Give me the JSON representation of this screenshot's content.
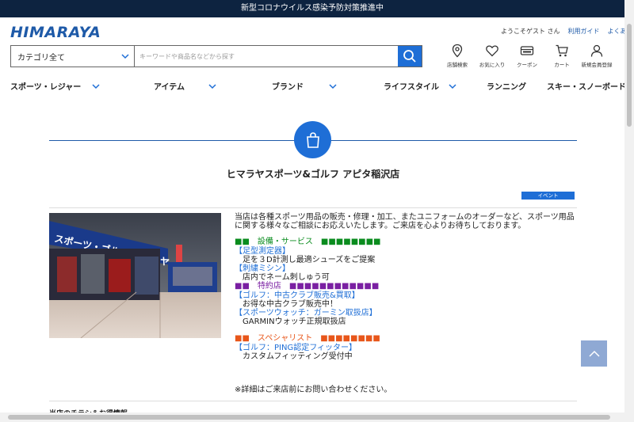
{
  "topbar": {
    "text": "新型コロナウイルス感染予防対策推進中"
  },
  "header": {
    "logo": "HIMARAYA",
    "welcome": "ようこそゲスト さん",
    "guide_link": "利用ガイド",
    "faq_link": "よくあ"
  },
  "search": {
    "category_label": "カテゴリ全て",
    "placeholder": "キーワードや商品名などから探す",
    "value": ""
  },
  "icons": [
    {
      "label": "店舗検索",
      "icon": "map-pin-icon"
    },
    {
      "label": "お気に入り",
      "icon": "heart-icon"
    },
    {
      "label": "クーポン",
      "icon": "coupon-icon"
    },
    {
      "label": "カート",
      "icon": "cart-icon"
    },
    {
      "label": "新規会員登録",
      "icon": "user-icon"
    }
  ],
  "nav": [
    {
      "label": "スポーツ・レジャー",
      "has_dropdown": true
    },
    {
      "label": "アイテム",
      "has_dropdown": true
    },
    {
      "label": "ブランド",
      "has_dropdown": true
    },
    {
      "label": "ライフスタイル",
      "has_dropdown": true
    },
    {
      "label": "ランニング",
      "has_dropdown": false
    },
    {
      "label": "スキー・スノーボード",
      "has_dropdown": false
    }
  ],
  "store": {
    "title": "ヒマラヤスポーツ&ゴルフ アピタ稲沢店",
    "badge": "イベント",
    "intro": "当店は各種スポーツ用品の販売・修理・加工、またユニフォームのオーダーなど、スポーツ用品に関する様々なご相談にお応えいたします。ご来店を心よりお待ちしております。",
    "photo_sign": "スポーツ・ゴルフ ヒマラヤ",
    "sections": [
      {
        "heading": "■■　設備・サービス　■■■■■■■■",
        "color": "green",
        "items": [
          {
            "link": "【足型測定器】",
            "desc": "足を３D計測し最適シューズをご提案"
          },
          {
            "link": "【刺繍ミシン】",
            "desc": "店内でネーム刺しゅう可"
          }
        ]
      },
      {
        "heading": "■■　特約店　■■■■■■■■■■■■",
        "color": "purple",
        "items": [
          {
            "link": "【ゴルフ：中古クラブ販売&買取】",
            "desc": "お得な中古クラブ販売中！"
          },
          {
            "link": "【スポーツウォッチ：ガーミン取扱店】",
            "desc": "GARMINウォッチ正規取扱店"
          }
        ]
      },
      {
        "heading": "■■　スペシャリスト　■■■■■■■■",
        "color": "orange",
        "items": [
          {
            "link": "【ゴルフ：PING認定フィッター】",
            "desc": "カスタムフィッティング受付中"
          }
        ]
      }
    ],
    "note": "※詳細はご来店前にお問い合わせください。",
    "flyer": "当店のチラシ＆お得情報"
  },
  "colors": {
    "topbar": "#0d2340",
    "brand": "#1e5aa8",
    "accent": "#1e6ed6",
    "green": "#0a8c1e",
    "purple": "#7a1fa2",
    "orange": "#e8561a"
  }
}
